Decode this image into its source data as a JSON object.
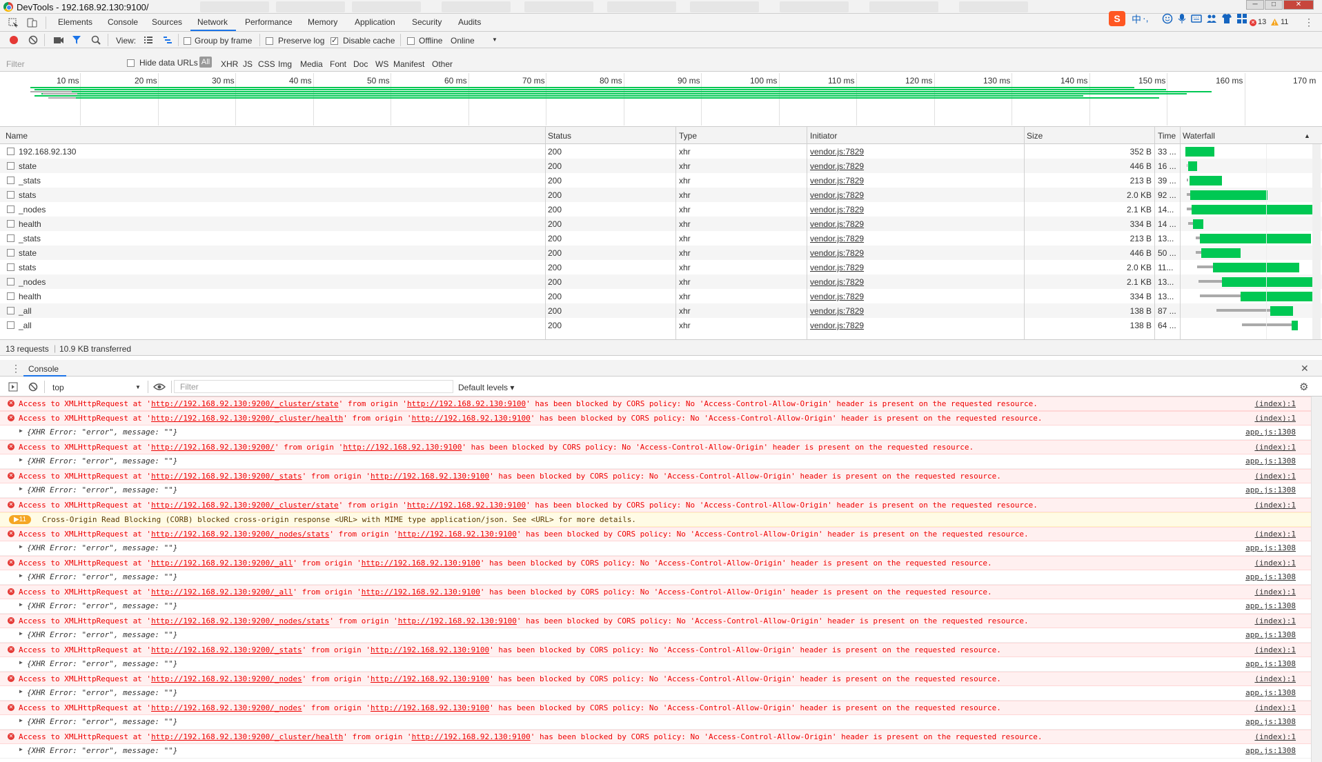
{
  "window": {
    "title": "DevTools - 192.168.92.130:9100/",
    "minimize": "─",
    "maximize": "□",
    "close": "✕"
  },
  "tabs": [
    "Elements",
    "Console",
    "Sources",
    "Network",
    "Performance",
    "Memory",
    "Application",
    "Security",
    "Audits"
  ],
  "active_tab": "Network",
  "tray": {
    "ime_char": "中",
    "punct": "·,",
    "errors": "13",
    "warnings": "11",
    "more": "⋮"
  },
  "netbar": {
    "view_label": "View:",
    "group_by_frame": "Group by frame",
    "preserve_log": "Preserve log",
    "disable_cache": "Disable cache",
    "offline": "Offline",
    "throttle": "Online",
    "throttle_arrow": "▼"
  },
  "filterbar": {
    "placeholder": "Filter",
    "hide_data_urls": "Hide data URLs",
    "all": "All",
    "types": [
      "XHR",
      "JS",
      "CSS",
      "Img",
      "Media",
      "Font",
      "Doc",
      "WS",
      "Manifest",
      "Other"
    ]
  },
  "overview": {
    "ticks": [
      "10 ms",
      "20 ms",
      "30 ms",
      "40 ms",
      "50 ms",
      "60 ms",
      "70 ms",
      "80 ms",
      "90 ms",
      "100 ms",
      "110 ms",
      "120 ms",
      "130 ms",
      "140 ms",
      "150 ms",
      "160 ms",
      "170 m"
    ]
  },
  "columns": {
    "name": "Name",
    "status": "Status",
    "type": "Type",
    "initiator": "Initiator",
    "size": "Size",
    "time": "Time",
    "waterfall": "Waterfall",
    "sort_arrow": "▲"
  },
  "requests": [
    {
      "name": "192.168.92.130",
      "status": "200",
      "type": "xhr",
      "initiator": "vendor.js:7829",
      "size": "352 B",
      "time": "33 ...",
      "wait": [
        0.02,
        0.02
      ],
      "recv": [
        0.02,
        0.24
      ]
    },
    {
      "name": "state",
      "status": "200",
      "type": "xhr",
      "initiator": "vendor.js:7829",
      "size": "446 B",
      "time": "16 ...",
      "wait": [
        0.03,
        0.03
      ],
      "recv": [
        0.04,
        0.11
      ]
    },
    {
      "name": "_stats",
      "status": "200",
      "type": "xhr",
      "initiator": "vendor.js:7829",
      "size": "213 B",
      "time": "39 ...",
      "wait": [
        0.03,
        0.04
      ],
      "recv": [
        0.05,
        0.3
      ]
    },
    {
      "name": "stats",
      "status": "200",
      "type": "xhr",
      "initiator": "vendor.js:7829",
      "size": "2.0 KB",
      "time": "92 ...",
      "wait": [
        0.03,
        0.06
      ],
      "recv": [
        0.06,
        0.65
      ]
    },
    {
      "name": "_nodes",
      "status": "200",
      "type": "xhr",
      "initiator": "vendor.js:7829",
      "size": "2.1 KB",
      "time": "14...",
      "wait": [
        0.03,
        0.07
      ],
      "recv": [
        0.07,
        0.99
      ]
    },
    {
      "name": "health",
      "status": "200",
      "type": "xhr",
      "initiator": "vendor.js:7829",
      "size": "334 B",
      "time": "14 ...",
      "wait": [
        0.04,
        0.08
      ],
      "recv": [
        0.08,
        0.16
      ]
    },
    {
      "name": "_stats",
      "status": "200",
      "type": "xhr",
      "initiator": "vendor.js:7829",
      "size": "213 B",
      "time": "13...",
      "wait": [
        0.1,
        0.13
      ],
      "recv": [
        0.13,
        0.98
      ]
    },
    {
      "name": "state",
      "status": "200",
      "type": "xhr",
      "initiator": "vendor.js:7829",
      "size": "446 B",
      "time": "50 ...",
      "wait": [
        0.1,
        0.14
      ],
      "recv": [
        0.14,
        0.44
      ]
    },
    {
      "name": "stats",
      "status": "200",
      "type": "xhr",
      "initiator": "vendor.js:7829",
      "size": "2.0 KB",
      "time": "11...",
      "wait": [
        0.11,
        0.23
      ],
      "recv": [
        0.23,
        0.89
      ]
    },
    {
      "name": "_nodes",
      "status": "200",
      "type": "xhr",
      "initiator": "vendor.js:7829",
      "size": "2.1 KB",
      "time": "13...",
      "wait": [
        0.12,
        0.3
      ],
      "recv": [
        0.3,
        1.0
      ]
    },
    {
      "name": "health",
      "status": "200",
      "type": "xhr",
      "initiator": "vendor.js:7829",
      "size": "334 B",
      "time": "13...",
      "wait": [
        0.13,
        0.44
      ],
      "recv": [
        0.44,
        1.0
      ]
    },
    {
      "name": "_all",
      "status": "200",
      "type": "xhr",
      "initiator": "vendor.js:7829",
      "size": "138 B",
      "time": "87 ...",
      "wait": [
        0.26,
        0.67
      ],
      "recv": [
        0.67,
        0.84
      ]
    },
    {
      "name": "_all",
      "status": "200",
      "type": "xhr",
      "initiator": "vendor.js:7829",
      "size": "138 B",
      "time": "64 ...",
      "wait": [
        0.45,
        0.83
      ],
      "recv": [
        0.83,
        0.88
      ]
    }
  ],
  "summary": {
    "requests": "13 requests",
    "sep": "|",
    "transferred": "10.9 KB transferred"
  },
  "drawer": {
    "menu": "⋮",
    "tab": "Console",
    "close": "✕"
  },
  "console": {
    "context": "top",
    "context_arrow": "▼",
    "filter_placeholder": "Filter",
    "levels": "Default levels ▾",
    "settings": "⚙"
  },
  "messages": [
    {
      "kind": "err",
      "pre": "Access to XMLHttpRequest at '",
      "url": "http://192.168.92.130:9200/_cluster/state",
      "mid": "' from origin '",
      "origin": "http://192.168.92.130:9100",
      "post": "' has been blocked by CORS policy: No 'Access-Control-Allow-Origin' header is present on the requested resource.",
      "src": "(index):1"
    },
    {
      "kind": "err",
      "pre": "Access to XMLHttpRequest at '",
      "url": "http://192.168.92.130:9200/_cluster/health",
      "mid": "' from origin '",
      "origin": "http://192.168.92.130:9100",
      "post": "' has been blocked by CORS policy: No 'Access-Control-Allow-Origin' header is present on the requested resource.",
      "src": "(index):1"
    },
    {
      "kind": "obj",
      "text": "{XHR Error: \"error\", message: \"\"}",
      "src": "app.js:1308"
    },
    {
      "kind": "err",
      "pre": "Access to XMLHttpRequest at '",
      "url": "http://192.168.92.130:9200/",
      "mid": "' from origin '",
      "origin": "http://192.168.92.130:9100",
      "post": "' has been blocked by CORS policy: No 'Access-Control-Allow-Origin' header is present on the requested resource.",
      "src": "(index):1"
    },
    {
      "kind": "obj",
      "text": "{XHR Error: \"error\", message: \"\"}",
      "src": "app.js:1308"
    },
    {
      "kind": "err",
      "pre": "Access to XMLHttpRequest at '",
      "url": "http://192.168.92.130:9200/_stats",
      "mid": "' from origin '",
      "origin": "http://192.168.92.130:9100",
      "post": "' has been blocked by CORS policy: No 'Access-Control-Allow-Origin' header is present on the requested resource.",
      "src": "(index):1"
    },
    {
      "kind": "obj",
      "text": "{XHR Error: \"error\", message: \"\"}",
      "src": "app.js:1308"
    },
    {
      "kind": "err",
      "pre": "Access to XMLHttpRequest at '",
      "url": "http://192.168.92.130:9200/_cluster/state",
      "mid": "' from origin '",
      "origin": "http://192.168.92.130:9100",
      "post": "' has been blocked by CORS policy: No 'Access-Control-Allow-Origin' header is present on the requested resource.",
      "src": "(index):1"
    },
    {
      "kind": "warn",
      "badge": "11",
      "text": "Cross-Origin Read Blocking (CORB) blocked cross-origin response <URL> with MIME type application/json. See <URL> for more details."
    },
    {
      "kind": "err",
      "pre": "Access to XMLHttpRequest at '",
      "url": "http://192.168.92.130:9200/_nodes/stats",
      "mid": "' from origin '",
      "origin": "http://192.168.92.130:9100",
      "post": "' has been blocked by CORS policy: No 'Access-Control-Allow-Origin' header is present on the requested resource.",
      "src": "(index):1"
    },
    {
      "kind": "obj",
      "text": "{XHR Error: \"error\", message: \"\"}",
      "src": "app.js:1308"
    },
    {
      "kind": "err",
      "pre": "Access to XMLHttpRequest at '",
      "url": "http://192.168.92.130:9200/_all",
      "mid": "' from origin '",
      "origin": "http://192.168.92.130:9100",
      "post": "' has been blocked by CORS policy: No 'Access-Control-Allow-Origin' header is present on the requested resource.",
      "src": "(index):1"
    },
    {
      "kind": "obj",
      "text": "{XHR Error: \"error\", message: \"\"}",
      "src": "app.js:1308"
    },
    {
      "kind": "err",
      "pre": "Access to XMLHttpRequest at '",
      "url": "http://192.168.92.130:9200/_all",
      "mid": "' from origin '",
      "origin": "http://192.168.92.130:9100",
      "post": "' has been blocked by CORS policy: No 'Access-Control-Allow-Origin' header is present on the requested resource.",
      "src": "(index):1"
    },
    {
      "kind": "obj",
      "text": "{XHR Error: \"error\", message: \"\"}",
      "src": "app.js:1308"
    },
    {
      "kind": "err",
      "pre": "Access to XMLHttpRequest at '",
      "url": "http://192.168.92.130:9200/_nodes/stats",
      "mid": "' from origin '",
      "origin": "http://192.168.92.130:9100",
      "post": "' has been blocked by CORS policy: No 'Access-Control-Allow-Origin' header is present on the requested resource.",
      "src": "(index):1"
    },
    {
      "kind": "obj",
      "text": "{XHR Error: \"error\", message: \"\"}",
      "src": "app.js:1308"
    },
    {
      "kind": "err",
      "pre": "Access to XMLHttpRequest at '",
      "url": "http://192.168.92.130:9200/_stats",
      "mid": "' from origin '",
      "origin": "http://192.168.92.130:9100",
      "post": "' has been blocked by CORS policy: No 'Access-Control-Allow-Origin' header is present on the requested resource.",
      "src": "(index):1"
    },
    {
      "kind": "obj",
      "text": "{XHR Error: \"error\", message: \"\"}",
      "src": "app.js:1308"
    },
    {
      "kind": "err",
      "pre": "Access to XMLHttpRequest at '",
      "url": "http://192.168.92.130:9200/_nodes",
      "mid": "' from origin '",
      "origin": "http://192.168.92.130:9100",
      "post": "' has been blocked by CORS policy: No 'Access-Control-Allow-Origin' header is present on the requested resource.",
      "src": "(index):1"
    },
    {
      "kind": "obj",
      "text": "{XHR Error: \"error\", message: \"\"}",
      "src": "app.js:1308"
    },
    {
      "kind": "err",
      "pre": "Access to XMLHttpRequest at '",
      "url": "http://192.168.92.130:9200/_nodes",
      "mid": "' from origin '",
      "origin": "http://192.168.92.130:9100",
      "post": "' has been blocked by CORS policy: No 'Access-Control-Allow-Origin' header is present on the requested resource.",
      "src": "(index):1"
    },
    {
      "kind": "obj",
      "text": "{XHR Error: \"error\", message: \"\"}",
      "src": "app.js:1308"
    },
    {
      "kind": "err",
      "pre": "Access to XMLHttpRequest at '",
      "url": "http://192.168.92.130:9200/_cluster/health",
      "mid": "' from origin '",
      "origin": "http://192.168.92.130:9100",
      "post": "' has been blocked by CORS policy: No 'Access-Control-Allow-Origin' header is present on the requested resource.",
      "src": "(index):1"
    },
    {
      "kind": "obj",
      "text": "{XHR Error: \"error\", message: \"\"}",
      "src": "app.js:1308"
    }
  ]
}
